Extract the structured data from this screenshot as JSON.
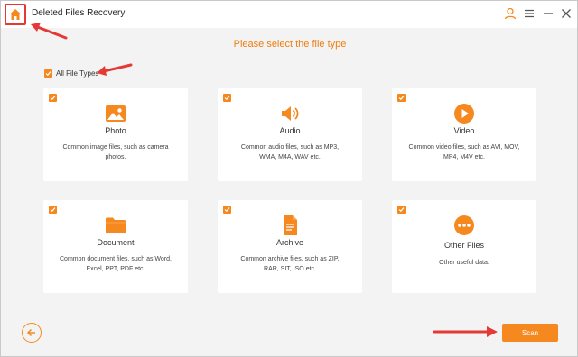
{
  "window": {
    "title": "Deleted Files Recovery",
    "controls": [
      "user-icon",
      "menu-icon",
      "minimize-icon",
      "close-icon"
    ]
  },
  "heading": "Please select the file type",
  "all_file_types": {
    "label": "All File Types",
    "checked": true
  },
  "file_types": [
    {
      "label": "Photo",
      "icon": "photo-icon",
      "description": "Common image files, such as camera photos.",
      "checked": true
    },
    {
      "label": "Audio",
      "icon": "audio-icon",
      "description": "Common audio files, such as MP3, WMA, M4A, WAV etc.",
      "checked": true
    },
    {
      "label": "Video",
      "icon": "video-icon",
      "description": "Common video files, such as AVI, MOV, MP4, M4V etc.",
      "checked": true
    },
    {
      "label": "Document",
      "icon": "folder-icon",
      "description": "Common document files, such as Word, Excel, PPT, PDF etc.",
      "checked": true
    },
    {
      "label": "Archive",
      "icon": "archive-icon",
      "description": "Common archive files, such as ZIP, RAR, SIT, ISO etc.",
      "checked": true
    },
    {
      "label": "Other Files",
      "icon": "more-icon",
      "description": "Other useful data.",
      "checked": true
    }
  ],
  "footer": {
    "scan_label": "Scan",
    "back_icon": "back-arrow-icon"
  },
  "colors": {
    "accent": "#f5891f",
    "heading": "#f07c10",
    "annotation": "#e53935",
    "background": "#f3f3f3"
  }
}
